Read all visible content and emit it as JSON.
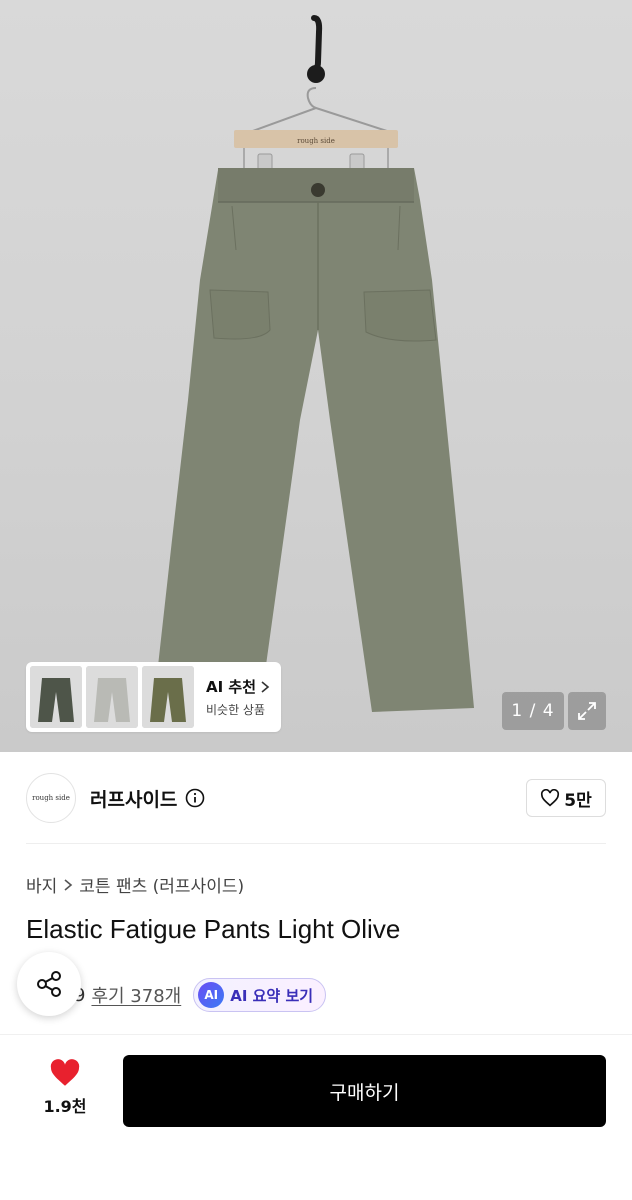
{
  "gallery": {
    "hanger_label": "rough side",
    "ai_recommendation": {
      "title": "AI 추천",
      "subtitle": "비슷한 상품"
    },
    "page_counter": "1 / 4",
    "thumbnail_colors": [
      "#4e5549",
      "#b9bab5",
      "#6a6e4a"
    ]
  },
  "brand": {
    "logo_text": "rough side",
    "name": "러프사이드",
    "like_count": "5만"
  },
  "breadcrumb": [
    "바지",
    "코튼 팬츠 (러프사이드)"
  ],
  "product": {
    "title": "Elastic Fatigue Pants Light Olive",
    "rating": "9",
    "review_label": "후기 378개",
    "ai_summary_badge": "AI",
    "ai_summary_label": "AI 요약 보기"
  },
  "bottom_bar": {
    "wish_count": "1.9천",
    "buy_label": "구매하기"
  },
  "colors": {
    "pants": "#7f8573",
    "buy_button": "#000000",
    "heart": "#e8212e",
    "ai_accent": "#3a2fb8"
  }
}
